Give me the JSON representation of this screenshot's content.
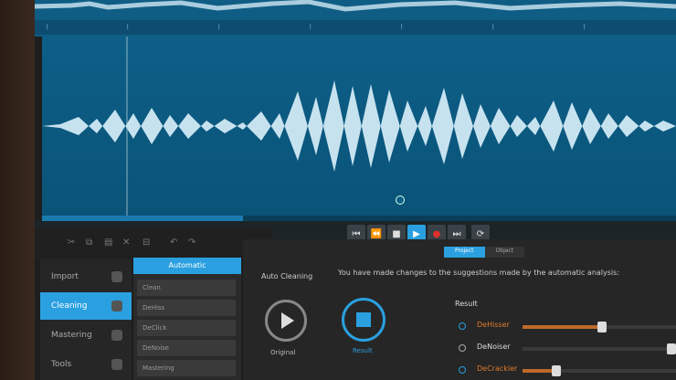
{
  "transport": {
    "buttons": [
      "to-start",
      "prev",
      "stop",
      "play",
      "record",
      "next",
      "loop"
    ]
  },
  "nav": {
    "items": [
      {
        "label": "Import"
      },
      {
        "label": "Cleaning"
      },
      {
        "label": "Mastering"
      },
      {
        "label": "Tools"
      }
    ]
  },
  "list": {
    "header": "Automatic",
    "items": [
      "Clean",
      "DeHiss",
      "DeClick",
      "DeNoise",
      "Mastering"
    ]
  },
  "main": {
    "tabs": [
      "Project",
      "Object"
    ],
    "auto_cleaning": "Auto Cleaning",
    "notice": "You have made changes to the suggestions made by the automatic analysis:",
    "original_label": "Original",
    "result_btn_label": "Result",
    "result_label": "Result",
    "rows": [
      {
        "name": "DeHisser",
        "value": 0.52,
        "active": true,
        "highlight": true
      },
      {
        "name": "DeNoiser",
        "value": 1.0,
        "active": false,
        "highlight": false
      },
      {
        "name": "DeCrackler",
        "value": 0.22,
        "active": true,
        "highlight": true
      }
    ]
  },
  "colors": {
    "accent": "#2aa0e0",
    "wave_bg": "#0d5f88",
    "highlight": "#e07a2a"
  }
}
